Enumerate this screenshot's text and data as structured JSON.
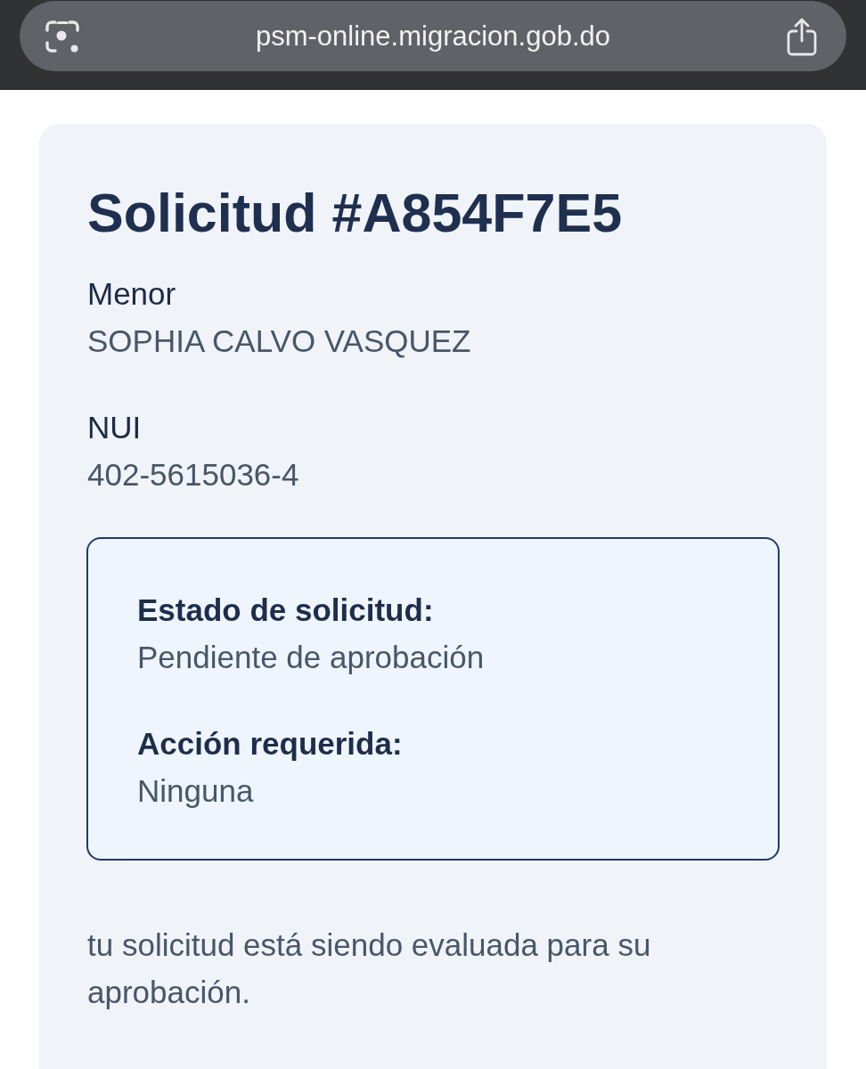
{
  "browser": {
    "url": "psm-online.migracion.gob.do"
  },
  "request": {
    "title": "Solicitud #A854F7E5",
    "fields": [
      {
        "label": "Menor",
        "value": "SOPHIA CALVO VASQUEZ"
      },
      {
        "label": "NUI",
        "value": "402-5615036-4"
      }
    ],
    "status_box": {
      "items": [
        {
          "label": "Estado de solicitud:",
          "value": "Pendiente de aprobación"
        },
        {
          "label": "Acción requerida:",
          "value": "Ninguna"
        }
      ]
    },
    "message": "tu solicitud está siendo evaluada para su aprobación."
  }
}
